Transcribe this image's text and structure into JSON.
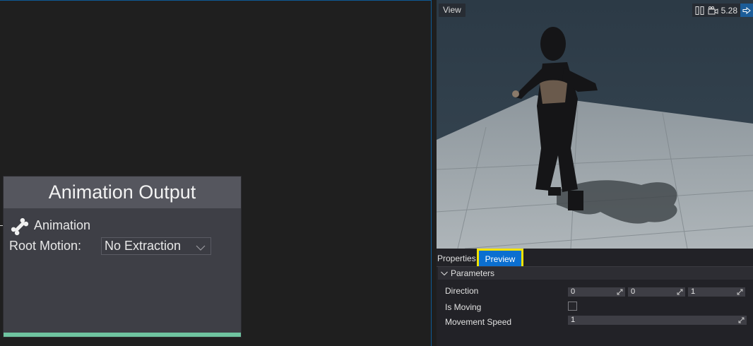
{
  "graph": {
    "node": {
      "title": "Animation Output",
      "port_label": "Animation",
      "root_motion_label": "Root Motion:",
      "root_motion_value": "No Extraction"
    }
  },
  "viewport": {
    "view_button": "View",
    "speed_value": "5.28"
  },
  "panel": {
    "tabs": [
      {
        "label": "Properties",
        "active": false
      },
      {
        "label": "Preview",
        "active": true
      }
    ],
    "section_title": "Parameters",
    "direction": {
      "label": "Direction",
      "values": [
        "0",
        "0",
        "1"
      ]
    },
    "is_moving": {
      "label": "Is Moving",
      "checked": false
    },
    "movement_speed": {
      "label": "Movement Speed",
      "value": "1"
    }
  },
  "colors": {
    "accent": "#0b6fd0",
    "highlight": "#f2e400",
    "node_footer": "#6fc4a0"
  }
}
